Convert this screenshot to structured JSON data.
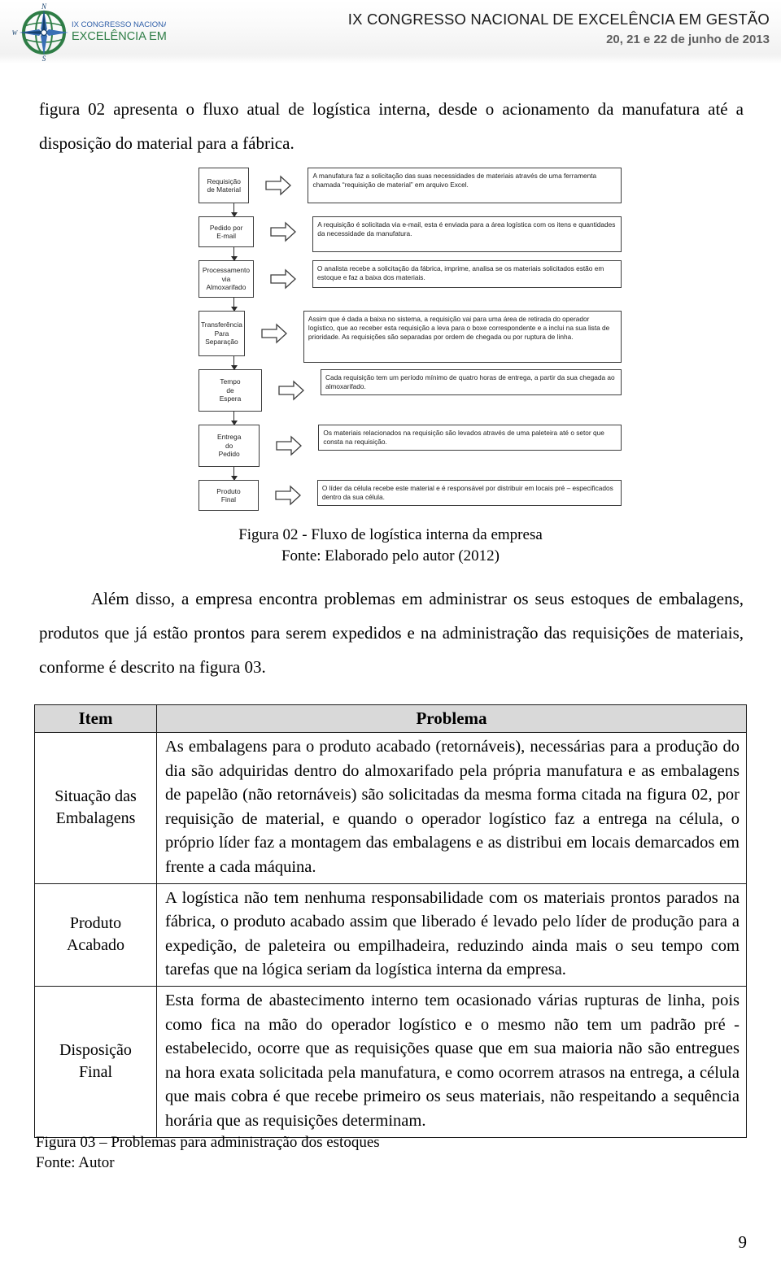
{
  "header": {
    "logo_alt": "IX Congresso Nacional de Excelência em Gestão",
    "logo_line1": "IX CONGRESSO NACIONAL DE",
    "logo_line2": "EXCELÊNCIA EM GESTÃO",
    "compass_n": "N",
    "compass_s": "S",
    "compass_w": "W",
    "title": "IX CONGRESSO NACIONAL DE EXCELÊNCIA EM GESTÃO",
    "date": "20, 21 e 22 de junho de 2013"
  },
  "intro_paragraph": "figura 02 apresenta o fluxo atual de logística interna, desde o acionamento da manufatura até a disposição do material para a fábrica.",
  "figure02": {
    "caption_line1": "Figura 02 - Fluxo de logística interna da empresa",
    "caption_line2": "Fonte: Elaborado pelo autor (2012)",
    "steps": [
      {
        "box": "Requisição\nde Material",
        "desc": "A manufatura faz a solicitação das suas necessidades de materiais através de uma ferramenta chamada “requisição de material” em arquivo Excel."
      },
      {
        "box": "Pedido por\nE-mail",
        "desc": "A requisição é solicitada via e-mail, esta é enviada para a área logística com os itens e quantidades da necessidade da manufatura."
      },
      {
        "box": "Processamento\nvia\nAlmoxarifado",
        "desc": "O analista recebe a solicitação da fábrica, imprime, analisa se os materiais solicitados estão em estoque e faz a baixa dos materiais."
      },
      {
        "box": "Transferência\nPara\nSeparação",
        "desc": "Assim que é dada a baixa no sistema, a requisição vai para uma área de retirada do operador logístico, que ao receber esta requisição a leva para o boxe correspondente e a inclui na sua lista de prioridade. As requisições são separadas por ordem de chegada ou por ruptura de linha."
      },
      {
        "box": "Tempo\nde\nEspera",
        "desc": "Cada requisição tem um período mínimo de quatro horas de entrega, a partir da sua chegada ao almoxarifado."
      },
      {
        "box": "Entrega\ndo\nPedido",
        "desc": "Os materiais relacionados na requisição são levados através de uma paleteira até o setor que consta na requisição."
      },
      {
        "box": "Produto\nFinal",
        "desc": "O líder da célula recebe este material e é responsável por distribuir em locais pré – especificados dentro da sua célula."
      }
    ]
  },
  "after_figure_paragraph": "Além disso, a empresa encontra problemas em administrar os seus estoques de embalagens, produtos que já estão prontos para serem expedidos e na administração das requisições de materiais, conforme é descrito na figura 03.",
  "table": {
    "headers": [
      "Item",
      "Problema"
    ],
    "rows": [
      {
        "item": "Situação das\nEmbalagens",
        "problema": "As embalagens para o produto acabado (retornáveis), necessárias para a produção do dia são adquiridas dentro do almoxarifado pela própria manufatura e as embalagens de papelão (não retornáveis) são solicitadas da mesma forma citada na figura 02, por requisição de material, e quando o operador logístico faz a entrega na célula, o próprio líder faz a montagem das embalagens e as distribui em locais demarcados em frente a cada máquina."
      },
      {
        "item": "Produto\nAcabado",
        "problema": "A logística não tem nenhuma responsabilidade com os materiais prontos parados na fábrica, o produto acabado assim que liberado é levado pelo líder de produção para a expedição, de paleteira ou empilhadeira, reduzindo ainda mais o seu tempo com tarefas que na lógica seriam da logística interna da empresa."
      },
      {
        "item": "Disposição\nFinal",
        "problema": "Esta forma de abastecimento interno tem ocasionado várias rupturas de linha, pois como fica na mão do operador logístico e o mesmo não tem um padrão pré - estabelecido, ocorre que as requisições quase que em sua maioria não são entregues na hora exata solicitada pela manufatura, e como ocorrem atrasos na entrega, a célula que mais cobra é que recebe primeiro os seus materiais, não respeitando a sequência horária que as requisições determinam."
      }
    ],
    "caption_line1": "Figura 03 – Problemas para administração dos estoques",
    "caption_line2": "Fonte: Autor"
  },
  "page_number": "9",
  "colors": {
    "header_band": "#f1f1f1",
    "table_header_fill": "#d9d9d9",
    "logo_green": "#2e7d46",
    "logo_blue": "#2f5fa8",
    "rule": "#1a1a1a"
  }
}
